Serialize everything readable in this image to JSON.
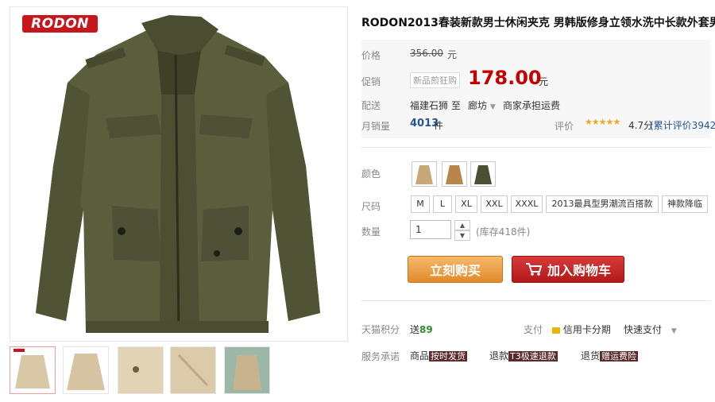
{
  "brand": {
    "logo_text": "RODON"
  },
  "product": {
    "title": "RODON2013春装新款男士休闲夹克 男韩版修身立领水洗中长款外套男",
    "price_label": "价格",
    "original_price": "356.00",
    "original_unit": "元",
    "promo_label": "促销",
    "promo_tag": "新品煎狂购",
    "promo_price": "178.00",
    "promo_unit": "元",
    "shipping_label": "配送",
    "ship_from": "福建石狮",
    "ship_to_word": "至",
    "ship_dest": "廊坊",
    "ship_fee": "商家承担运费",
    "sales_label": "月销量",
    "sales_count": "4013",
    "sales_unit": "件",
    "rating_label": "评价",
    "rating_stars": "★★★★★",
    "rating_score": "4.7分",
    "rating_total": "(累计评价3942)"
  },
  "options": {
    "color_label": "颜色",
    "size_label": "尺码",
    "sizes": [
      "M",
      "L",
      "XL",
      "XXL",
      "XXXL",
      "2013最具型男潮流百搭款",
      "神款降临"
    ],
    "qty_label": "数量",
    "qty_value": "1",
    "stock_text": "(库存418件)"
  },
  "actions": {
    "buy_now": "立刻购买",
    "add_to_cart": "加入购物车"
  },
  "footer": {
    "points_label": "天猫积分",
    "points_text": "送",
    "points_value": "89",
    "pay_label": "支付",
    "pay_installment": "信用卡分期",
    "pay_quick": "快速支付",
    "service_label": "服务承诺",
    "svc1_prefix": "商品",
    "svc1_tag": "按时发货",
    "svc2_prefix": "退款",
    "svc2_tag": "T3极速退款",
    "svc3_prefix": "退货",
    "svc3_tag": "赠运费险"
  },
  "colors": {
    "price_red": "#c40000",
    "buy_orange": "#e08a2a",
    "cart_red": "#b21a1a",
    "jacket_olive": "#5b5e3c",
    "swatch_khaki": "#c8a87a",
    "swatch_camel": "#b8864a",
    "swatch_olive": "#4b5034"
  }
}
